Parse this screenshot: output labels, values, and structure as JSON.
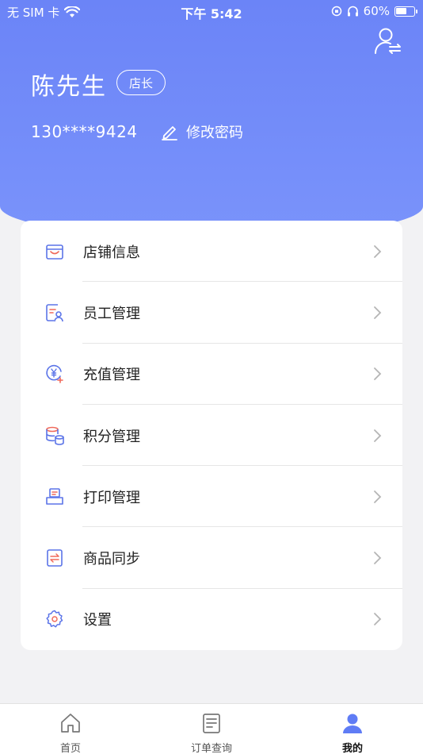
{
  "status_bar": {
    "carrier": "无 SIM 卡",
    "time": "下午 5:42",
    "battery_percent": "60%",
    "battery_level": 0.6
  },
  "profile": {
    "name": "陈先生",
    "role": "店长",
    "phone": "130****9424",
    "change_password": "修改密码"
  },
  "menu": {
    "items": [
      {
        "label": "店铺信息",
        "icon": "store-icon"
      },
      {
        "label": "员工管理",
        "icon": "staff-icon"
      },
      {
        "label": "充值管理",
        "icon": "recharge-icon"
      },
      {
        "label": "积分管理",
        "icon": "points-icon"
      },
      {
        "label": "打印管理",
        "icon": "printer-icon"
      },
      {
        "label": "商品同步",
        "icon": "sync-icon"
      },
      {
        "label": "设置",
        "icon": "gear-icon"
      }
    ]
  },
  "tabbar": {
    "tabs": [
      {
        "label": "首页",
        "icon": "home-icon"
      },
      {
        "label": "订单查询",
        "icon": "order-icon"
      },
      {
        "label": "我的",
        "icon": "person-icon",
        "active": true
      }
    ]
  },
  "colors": {
    "accent": "#6b84f7",
    "icon_blue": "#5b74e8",
    "icon_red": "#f06a5b",
    "active_tab": "#5f7cf5"
  }
}
